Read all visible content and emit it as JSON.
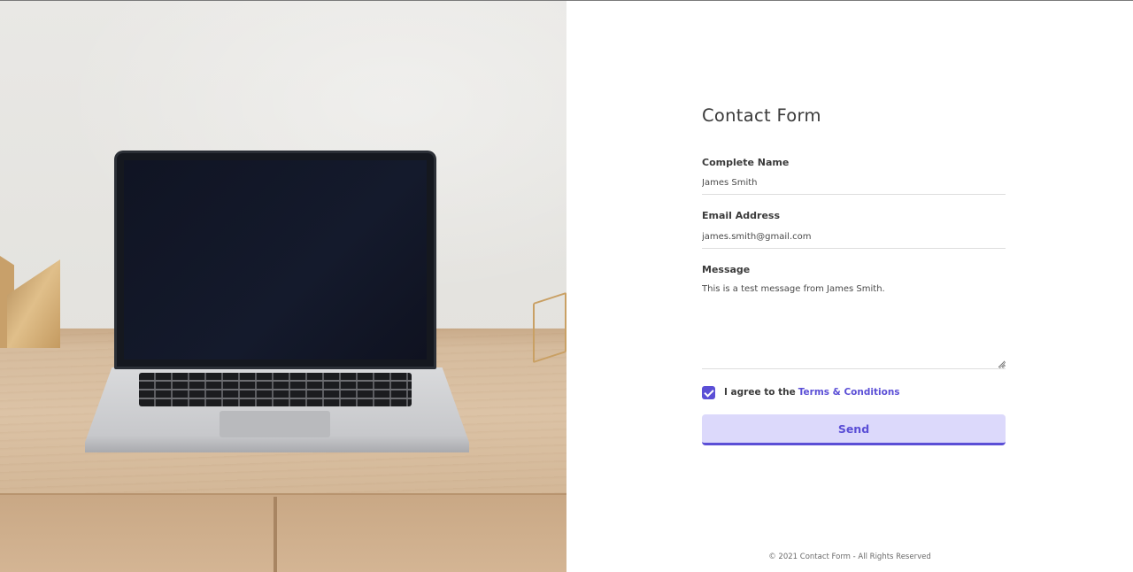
{
  "form": {
    "title": "Contact Form",
    "name_label": "Complete Name",
    "name_value": "James Smith",
    "email_label": "Email Address",
    "email_value": "james.smith@gmail.com",
    "message_label": "Message",
    "message_value": "This is a test message from James Smith.",
    "agree_text": "I agree to the",
    "terms_link": "Terms & Conditions",
    "agree_checked": true,
    "send_label": "Send"
  },
  "footer": {
    "text": "© 2021 Contact Form - All Rights Reserved"
  },
  "colors": {
    "accent": "#5b4fd6",
    "button_bg": "#dcd9fb",
    "text": "#3a3a3a"
  },
  "icons": {
    "checkbox": "check-icon",
    "resize": "resize-grip-icon"
  }
}
